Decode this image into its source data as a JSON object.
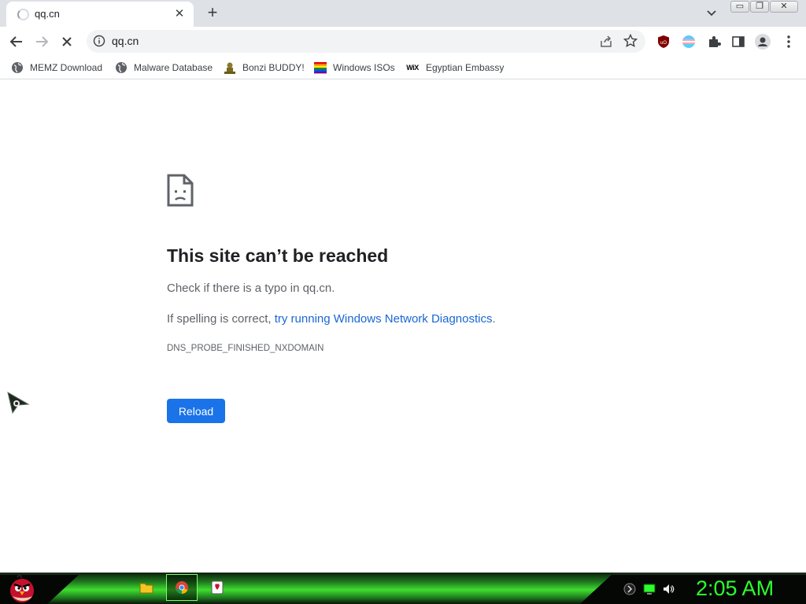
{
  "tab": {
    "title": "qq.cn",
    "close_glyph": "✕",
    "newtab_glyph": "+"
  },
  "window_controls": {
    "minimize": "▭",
    "maximize": "❐",
    "close": "✕"
  },
  "toolbar": {
    "url": "qq.cn"
  },
  "bookmarks": [
    {
      "label": "MEMZ Download",
      "icon": "globe-icon"
    },
    {
      "label": "Malware Database",
      "icon": "globe-icon"
    },
    {
      "label": "Bonzi BUDDY!",
      "icon": "bonzi-icon"
    },
    {
      "label": "Windows ISOs",
      "icon": "rainbow-flag-icon"
    },
    {
      "label": "Egyptian Embassy",
      "icon": "wix-icon",
      "icon_text": "WiX"
    }
  ],
  "error": {
    "title": "This site can’t be reached",
    "line1": "Check if there is a typo in qq.cn.",
    "line2_prefix": "If spelling is correct, ",
    "line2_link": "try running Windows Network Diagnostics",
    "line2_suffix": ".",
    "code": "DNS_PROBE_FINISHED_NXDOMAIN",
    "reload_label": "Reload"
  },
  "taskbar": {
    "clock": "2:05 AM"
  },
  "colors": {
    "accent": "#1a73e8",
    "link": "#1967d2",
    "clock": "#2dff2d",
    "taskbar_green": "#3fdc2f"
  }
}
